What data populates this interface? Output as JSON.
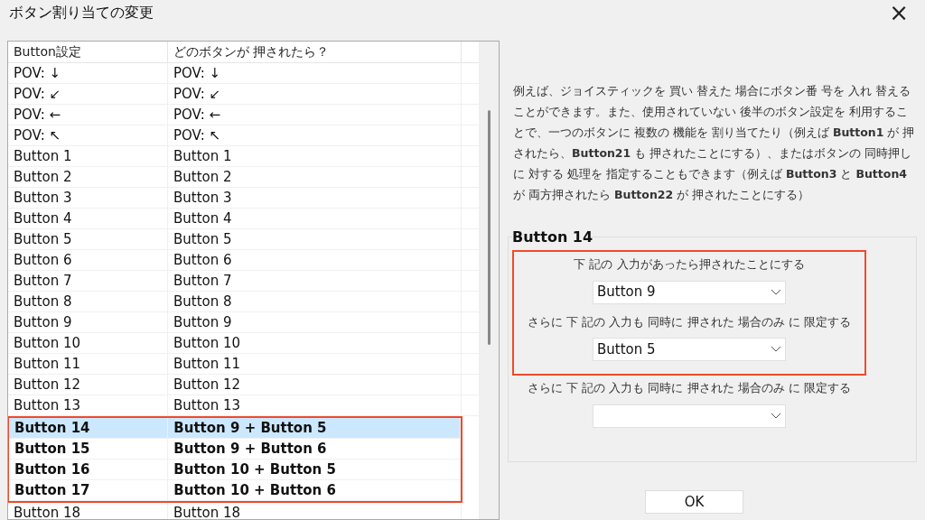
{
  "window": {
    "title": "ボタン割り当ての変更",
    "close_icon": "×"
  },
  "table": {
    "columns": [
      "Button設定",
      "どのボタンが 押されたら？"
    ],
    "rows": [
      {
        "cells": [
          "POV: ↓",
          "POV: ↓"
        ],
        "selected": false,
        "bold": false,
        "highlighted": false
      },
      {
        "cells": [
          "POV: ↙",
          "POV: ↙"
        ],
        "selected": false,
        "bold": false,
        "highlighted": false
      },
      {
        "cells": [
          "POV: ←",
          "POV: ←"
        ],
        "selected": false,
        "bold": false,
        "highlighted": false
      },
      {
        "cells": [
          "POV: ↖",
          "POV: ↖"
        ],
        "selected": false,
        "bold": false,
        "highlighted": false
      },
      {
        "cells": [
          "Button 1",
          "Button 1"
        ],
        "selected": false,
        "bold": false,
        "highlighted": false
      },
      {
        "cells": [
          "Button 2",
          "Button 2"
        ],
        "selected": false,
        "bold": false,
        "highlighted": false
      },
      {
        "cells": [
          "Button 3",
          "Button 3"
        ],
        "selected": false,
        "bold": false,
        "highlighted": false
      },
      {
        "cells": [
          "Button 4",
          "Button 4"
        ],
        "selected": false,
        "bold": false,
        "highlighted": false
      },
      {
        "cells": [
          "Button 5",
          "Button 5"
        ],
        "selected": false,
        "bold": false,
        "highlighted": false
      },
      {
        "cells": [
          "Button 6",
          "Button 6"
        ],
        "selected": false,
        "bold": false,
        "highlighted": false
      },
      {
        "cells": [
          "Button 7",
          "Button 7"
        ],
        "selected": false,
        "bold": false,
        "highlighted": false
      },
      {
        "cells": [
          "Button 8",
          "Button 8"
        ],
        "selected": false,
        "bold": false,
        "highlighted": false
      },
      {
        "cells": [
          "Button 9",
          "Button 9"
        ],
        "selected": false,
        "bold": false,
        "highlighted": false
      },
      {
        "cells": [
          "Button 10",
          "Button 10"
        ],
        "selected": false,
        "bold": false,
        "highlighted": false
      },
      {
        "cells": [
          "Button 11",
          "Button 11"
        ],
        "selected": false,
        "bold": false,
        "highlighted": false
      },
      {
        "cells": [
          "Button 12",
          "Button 12"
        ],
        "selected": false,
        "bold": false,
        "highlighted": false
      },
      {
        "cells": [
          "Button 13",
          "Button 13"
        ],
        "selected": false,
        "bold": false,
        "highlighted": false
      },
      {
        "cells": [
          "Button 14",
          "Button 9 + Button 5"
        ],
        "selected": true,
        "bold": true,
        "highlighted": true
      },
      {
        "cells": [
          "Button 15",
          "Button 9 + Button 6"
        ],
        "selected": false,
        "bold": true,
        "highlighted": true
      },
      {
        "cells": [
          "Button 16",
          "Button 10 + Button 5"
        ],
        "selected": false,
        "bold": true,
        "highlighted": true
      },
      {
        "cells": [
          "Button 17",
          "Button 10 + Button 6"
        ],
        "selected": false,
        "bold": true,
        "highlighted": true
      },
      {
        "cells": [
          "Button 18",
          "Button 18"
        ],
        "selected": false,
        "bold": false,
        "highlighted": false
      }
    ]
  },
  "description": "例えば、ジョイスティックを 買い 替えた 場合にボタン番 号を 入れ 替えることができます。また、使用されていない 後半のボタン設定を 利用することで、一つのボタンに 複数の 機能を 割り当てたり（例えば **Button1** が 押されたら、**Button21** も 押されたことにする）、またはボタンの 同時押しに 対する 処理を 指定することもできます（例えば **Button3** と **Button4** が 両方押されたら **Button22** が 押されたことにする）",
  "group": {
    "title": "Button 14",
    "fields": [
      {
        "label": "下 記の 入力があったら押されたことにする",
        "value": "Button 9",
        "highlighted": true
      },
      {
        "label": "さらに 下 記の 入力も 同時に 押された 場合のみ に 限定する",
        "value": "Button 5",
        "highlighted": true
      },
      {
        "label": "さらに 下 記の 入力も 同時に 押された 場合のみ に 限定する",
        "highlighted": false
      }
    ]
  },
  "ok_button": "OK"
}
